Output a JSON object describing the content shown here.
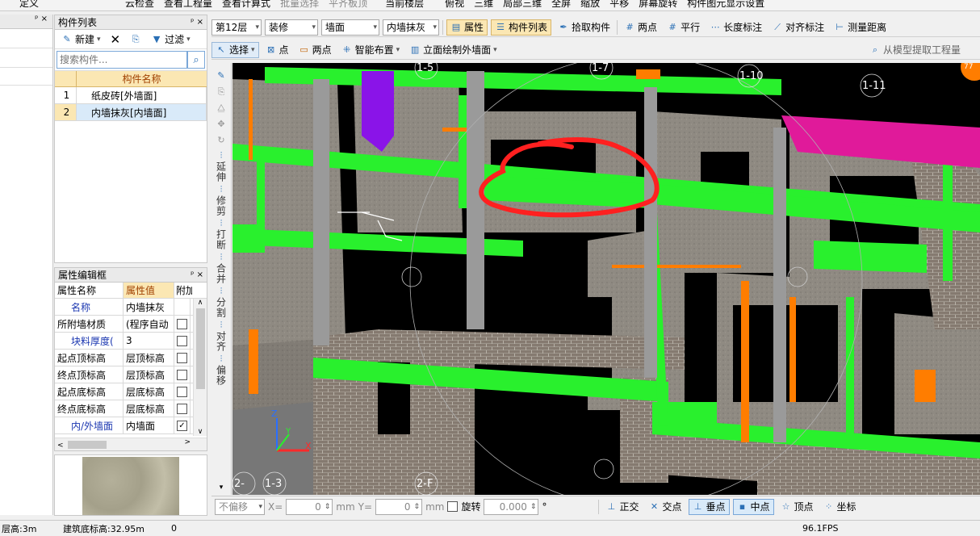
{
  "top_toolbar": {
    "items": [
      "定义",
      "云检查",
      "查看工程量",
      "查看计算式",
      "批量选择",
      "平齐板顶",
      "当前楼层",
      "俯视",
      "三维",
      "局部三维",
      "全屏",
      "缩放",
      "平移",
      "屏幕旋转",
      "构件图元显示设置"
    ]
  },
  "floor_toolbar": {
    "floor": "第12层",
    "category": "装修",
    "type": "墙面",
    "component": "内墙抹灰",
    "props_label": "属性",
    "list_label": "构件列表",
    "pick_label": "拾取构件",
    "two_points": "两点",
    "parallel": "平行",
    "length_mark": "长度标注",
    "align_mark": "对齐标注",
    "measure": "测量距离"
  },
  "draw_toolbar": {
    "select": "选择",
    "point": "点",
    "two_points": "两点",
    "smart_place": "智能布置",
    "elevation_wall": "立面绘制外墙面",
    "extract": "从模型提取工程量"
  },
  "component_list": {
    "title": "构件列表",
    "new_label": "新建",
    "filter_label": "过滤",
    "search_placeholder": "搜索构件...",
    "column": "构件名称",
    "rows": [
      {
        "num": "1",
        "name": "纸皮砖[外墙面]"
      },
      {
        "num": "2",
        "name": "内墙抹灰[内墙面]"
      }
    ]
  },
  "property_panel": {
    "title": "属性编辑框",
    "col_name": "属性名称",
    "col_value": "属性值",
    "col_extra": "附加",
    "rows": [
      {
        "name": "名称",
        "value": "内墙抹灰",
        "checkbox": false,
        "has_check": false,
        "blue": true
      },
      {
        "name": "所附墙材质",
        "value": "(程序自动",
        "has_check": true,
        "checked": false,
        "blue": false
      },
      {
        "name": "块料厚度(",
        "value": "3",
        "has_check": true,
        "checked": false,
        "blue": true
      },
      {
        "name": "起点顶标高",
        "value": "层顶标高",
        "has_check": true,
        "checked": false,
        "blue": false
      },
      {
        "name": "终点顶标高",
        "value": "层顶标高",
        "has_check": true,
        "checked": false,
        "blue": false
      },
      {
        "name": "起点底标高",
        "value": "层底标高",
        "has_check": true,
        "checked": false,
        "blue": false
      },
      {
        "name": "终点底标高",
        "value": "层底标高",
        "has_check": true,
        "checked": false,
        "blue": false
      },
      {
        "name": "内/外墙面",
        "value": "内墙面",
        "has_check": true,
        "checked": true,
        "blue": true
      }
    ]
  },
  "side_tools": [
    "延伸",
    "修剪",
    "打断",
    "合并",
    "分割",
    "对齐",
    "偏移"
  ],
  "axis_labels": [
    "1-5",
    "1-7",
    "1-10",
    "1-11",
    "2-F",
    "1-3",
    "2-"
  ],
  "zoom_badge": "77",
  "bottom_bar": {
    "offset": "不偏移",
    "x_label": "X=",
    "x_val": "0",
    "unit": "mm",
    "y_label": "Y=",
    "y_val": "0",
    "rotate": "旋转",
    "rotate_val": "0.000",
    "deg": "°",
    "snaps": [
      "正交",
      "交点",
      "垂点",
      "中点",
      "顶点",
      "坐标"
    ]
  },
  "status_bar": {
    "floor_height": "层高:3m",
    "base_elev": "建筑底标高:32.95m",
    "val": "0",
    "fps": "96.1FPS"
  }
}
